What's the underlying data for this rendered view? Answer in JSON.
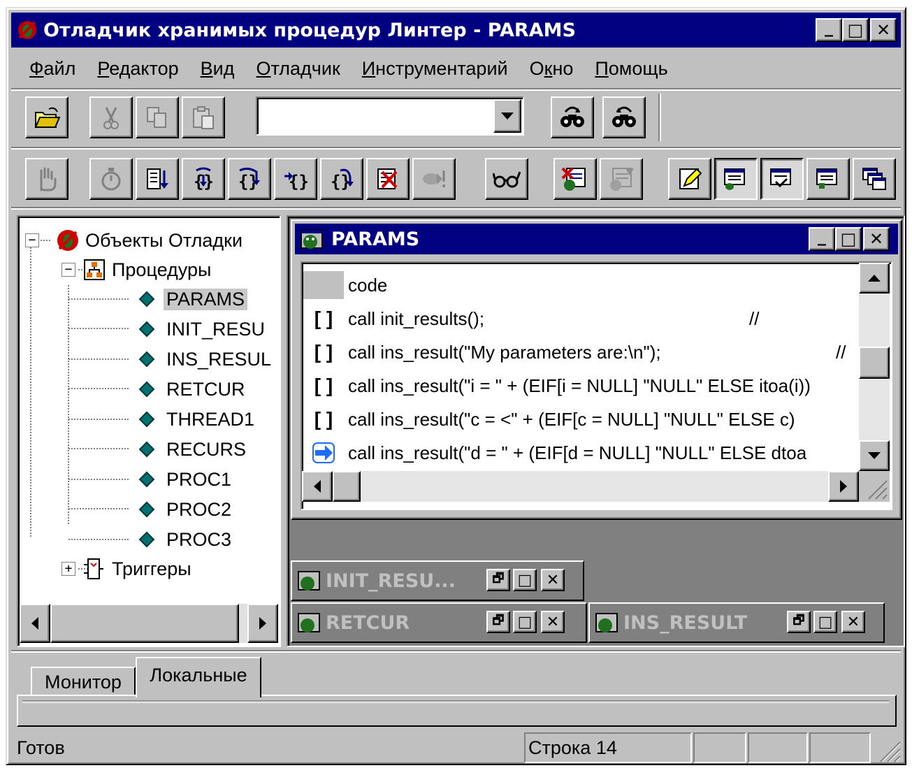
{
  "window": {
    "title": "Отладчик хранимых процедур Линтер - PARAMS",
    "minimize": "_",
    "maximize": "□",
    "close": "✕"
  },
  "menu": [
    {
      "hotkey": "Ф",
      "rest": "айл"
    },
    {
      "hotkey": "Р",
      "rest": "едактор"
    },
    {
      "hotkey": "В",
      "rest": "ид"
    },
    {
      "hotkey": "О",
      "rest": "тладчик"
    },
    {
      "hotkey": "И",
      "rest": "нструментарий"
    },
    {
      "pre": "О",
      "hotkey": "к",
      "rest": "но"
    },
    {
      "hotkey": "П",
      "rest": "омощь"
    }
  ],
  "toolbar": {
    "search_value": "",
    "icons_row1": [
      "open-folder-icon",
      "cut-icon",
      "copy-icon",
      "paste-icon",
      "find-next-icon",
      "find-prev-icon"
    ],
    "icons_row2": [
      "hand-stop-icon",
      "stopwatch-icon",
      "step-list-icon",
      "step-into-icon",
      "step-over-icon",
      "step-out-icon",
      "run-to-icon",
      "clear-breakpoints-icon",
      "run-to-cursor-icon",
      "watch-glasses-icon",
      "toggle-breakpoint-icon",
      "disabled-breakpoint-icon",
      "edit-icon",
      "window-view-1-icon",
      "window-view-2-icon",
      "window-view-3-icon",
      "cascade-icon"
    ]
  },
  "tree": {
    "root": "Объекты Отладки",
    "procedures_label": "Процедуры",
    "procedures": [
      "PARAMS",
      "INIT_RESU",
      "INS_RESUL",
      "RETCUR",
      "THREAD1",
      "RECURS",
      "PROC1",
      "PROC2",
      "PROC3"
    ],
    "selected": "PARAMS",
    "triggers_label": "Триггеры"
  },
  "editor": {
    "title": "PARAMS",
    "header": "code",
    "lines": [
      {
        "marker": "[ ]",
        "code": "call init_results();",
        "comment": "//"
      },
      {
        "marker": "[ ]",
        "code": "call ins_result(\"My parameters are:\\n\");",
        "comment": "//"
      },
      {
        "marker": "[ ]",
        "code": "call ins_result(\"i = \" + (EIF[i = NULL] \"NULL\" ELSE itoa(i))",
        "comment": ""
      },
      {
        "marker": "[ ]",
        "code": "call ins_result(\"c = <\" + (EIF[c = NULL] \"NULL\" ELSE c)",
        "comment": ""
      },
      {
        "marker": "arrow",
        "code": "call ins_result(\"d = \" + (EIF[d = NULL] \"NULL\" ELSE dtoa",
        "comment": ""
      }
    ]
  },
  "minimized_windows": [
    {
      "title": "INIT_RESU...",
      "restore": "🗗",
      "max": "□",
      "close": "✕"
    },
    {
      "title": "RETCUR",
      "restore": "🗗",
      "max": "□",
      "close": "✕"
    },
    {
      "title": "INS_RESULT",
      "restore": "🗗",
      "max": "□",
      "close": "✕"
    }
  ],
  "bottom_tabs": [
    "Монитор",
    "Локальные"
  ],
  "active_tab": "Локальные",
  "status": {
    "message": "Готов",
    "line": "Строка 14"
  },
  "colors": {
    "face": "#c0c0c0",
    "title_active": "#000080",
    "title_inactive": "#808080",
    "marker_arrow": "#1e6bff"
  }
}
